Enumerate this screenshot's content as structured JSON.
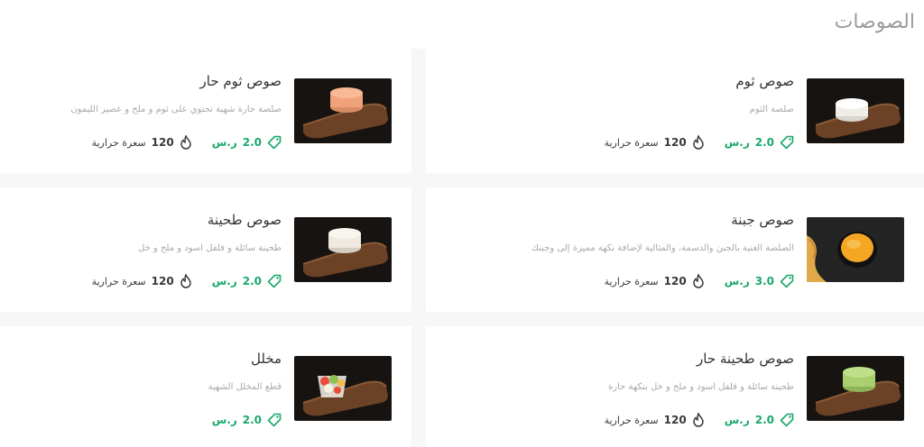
{
  "section": {
    "title": "الصوصات"
  },
  "currency": "ر.س",
  "calories_unit": "سعرة حرارية",
  "colors": {
    "accent": "#1aa86b",
    "text": "#333333",
    "muted": "#a9a9a9",
    "title": "#9c9c9c"
  },
  "items": [
    {
      "name": "صوص ثوم",
      "desc": "صلصة الثوم",
      "price": "2.0",
      "calories": "120",
      "image": "garlic-sauce-photo",
      "cup": "#f2f0ea"
    },
    {
      "name": "صوص ثوم حار",
      "desc": "صلصة حارة شهية تحتوي على ثوم و ملح و عصير الليمون",
      "price": "2.0",
      "calories": "120",
      "image": "spicy-garlic-sauce-photo",
      "cup": "#f2a27a"
    },
    {
      "name": "صوص جبنة",
      "desc": "الصلصة الغنية بالجبن والدسمة، والمثالية لإضافة نكهة مميزة إلى وجبتك",
      "price": "3.0",
      "calories": "120",
      "image": "cheese-sauce-photo",
      "cup": "#f5a623"
    },
    {
      "name": "صوص طحينة",
      "desc": "طحينة سائلة و فلفل اسود و ملح و خل",
      "price": "2.0",
      "calories": "120",
      "image": "tahini-sauce-photo",
      "cup": "#efe9df"
    },
    {
      "name": "صوص طحينة حار",
      "desc": "طحينة سائلة و فلفل اسود و ملح و خل بنكهة حارة",
      "price": "2.0",
      "calories": "120",
      "image": "spicy-tahini-sauce-photo",
      "cup": "#a9cf6e"
    },
    {
      "name": "مخلل",
      "desc": "قطع المخلل الشهية",
      "price": "2.0",
      "image": "pickles-photo",
      "cup": "#e8d8c4"
    }
  ]
}
